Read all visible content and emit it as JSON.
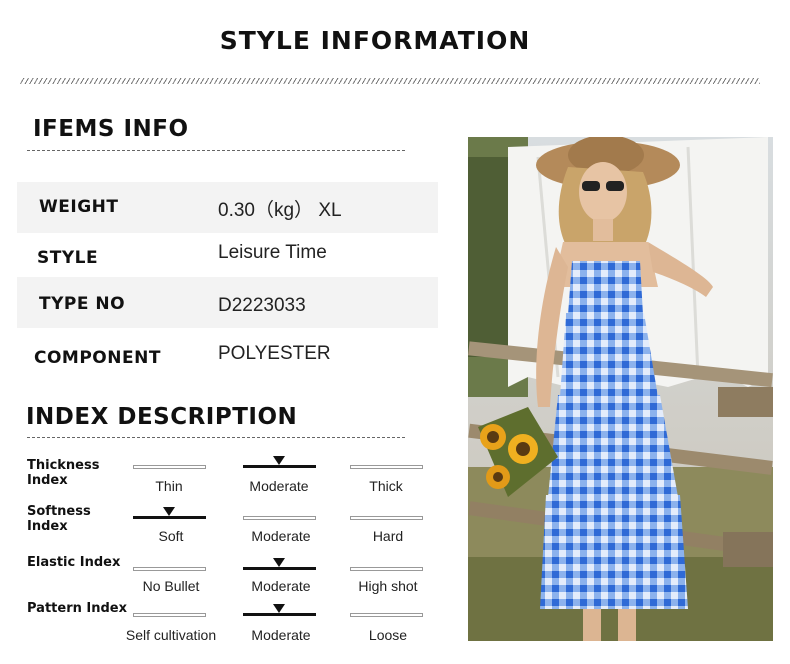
{
  "header": {
    "title": "STYLE INFORMATION"
  },
  "items_info": {
    "section_title": "IFEMS INFO",
    "rows": [
      {
        "label": "WEIGHT",
        "value": "0.30（kg） XL"
      },
      {
        "label": "STYLE",
        "value": "Leisure Time"
      },
      {
        "label": "TYPE NO",
        "value": "D2223033"
      },
      {
        "label": "COMPONENT",
        "value": "POLYESTER"
      }
    ]
  },
  "index_description": {
    "section_title": "INDEX DESCRIPTION",
    "indices": [
      {
        "name": "Thickness Index",
        "options": [
          "Thin",
          "Moderate",
          "Thick"
        ],
        "selected_index": 1
      },
      {
        "name": "Softness Index",
        "options": [
          "Soft",
          "Moderate",
          "Hard"
        ],
        "selected_index": 0
      },
      {
        "name": "Elastic Index",
        "options": [
          "No Bullet",
          "Moderate",
          "High shot"
        ],
        "selected_index": 1
      },
      {
        "name": "Pattern Index",
        "options": [
          "Self cultivation",
          "Moderate",
          "Loose"
        ],
        "selected_index": 1
      }
    ]
  },
  "colors": {
    "row_background": "#f3f3f3",
    "dress_blue": "#3f7fe0",
    "dress_light": "#dfe9fb",
    "marker": "#111111"
  }
}
